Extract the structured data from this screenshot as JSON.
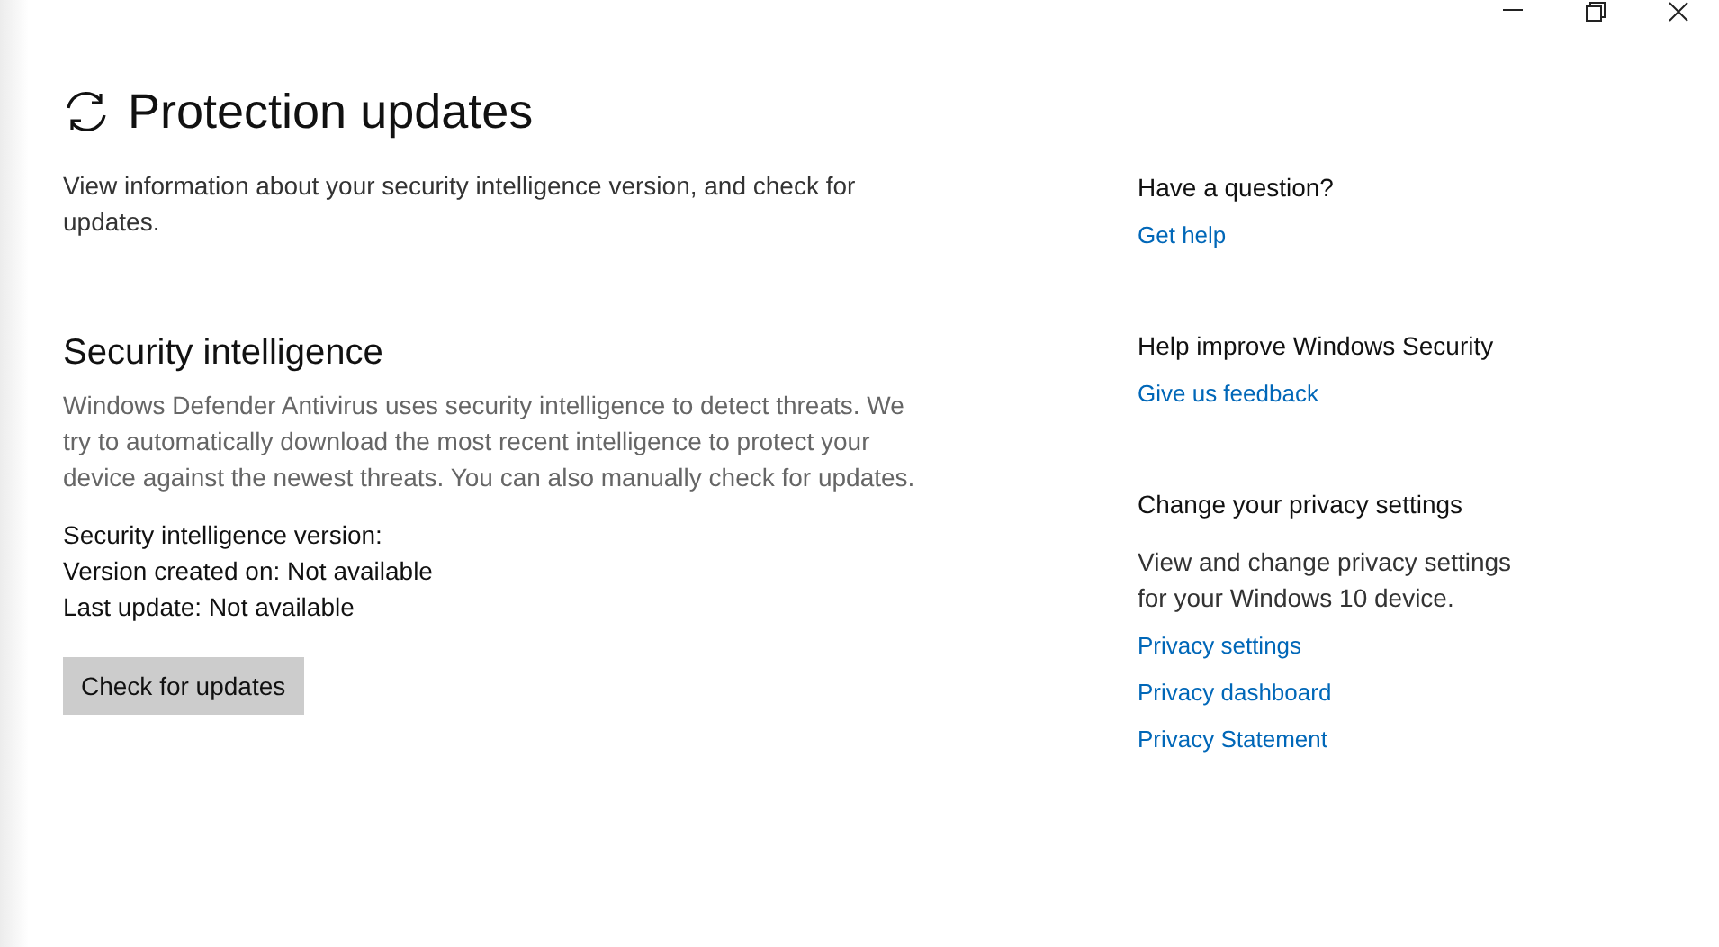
{
  "page": {
    "title": "Protection updates",
    "intro": "View information about your security intelligence version, and check for updates."
  },
  "section": {
    "heading": "Security intelligence",
    "body": "Windows Defender Antivirus uses security intelligence to detect threats. We try to automatically download the most recent intelligence to protect your device against the newest threats. You can also manually check for updates.",
    "details": [
      "Security intelligence version:",
      "Version created on: Not available",
      "Last update: Not available"
    ],
    "button": "Check for updates"
  },
  "sidebar": [
    {
      "heading": "Have a question?",
      "links": [
        "Get help"
      ]
    },
    {
      "heading": "Help improve Windows Security",
      "links": [
        "Give us feedback"
      ]
    },
    {
      "heading": "Change your privacy settings",
      "text": "View and change privacy settings for your Windows 10 device.",
      "links": [
        "Privacy settings",
        "Privacy dashboard",
        "Privacy Statement"
      ]
    }
  ]
}
